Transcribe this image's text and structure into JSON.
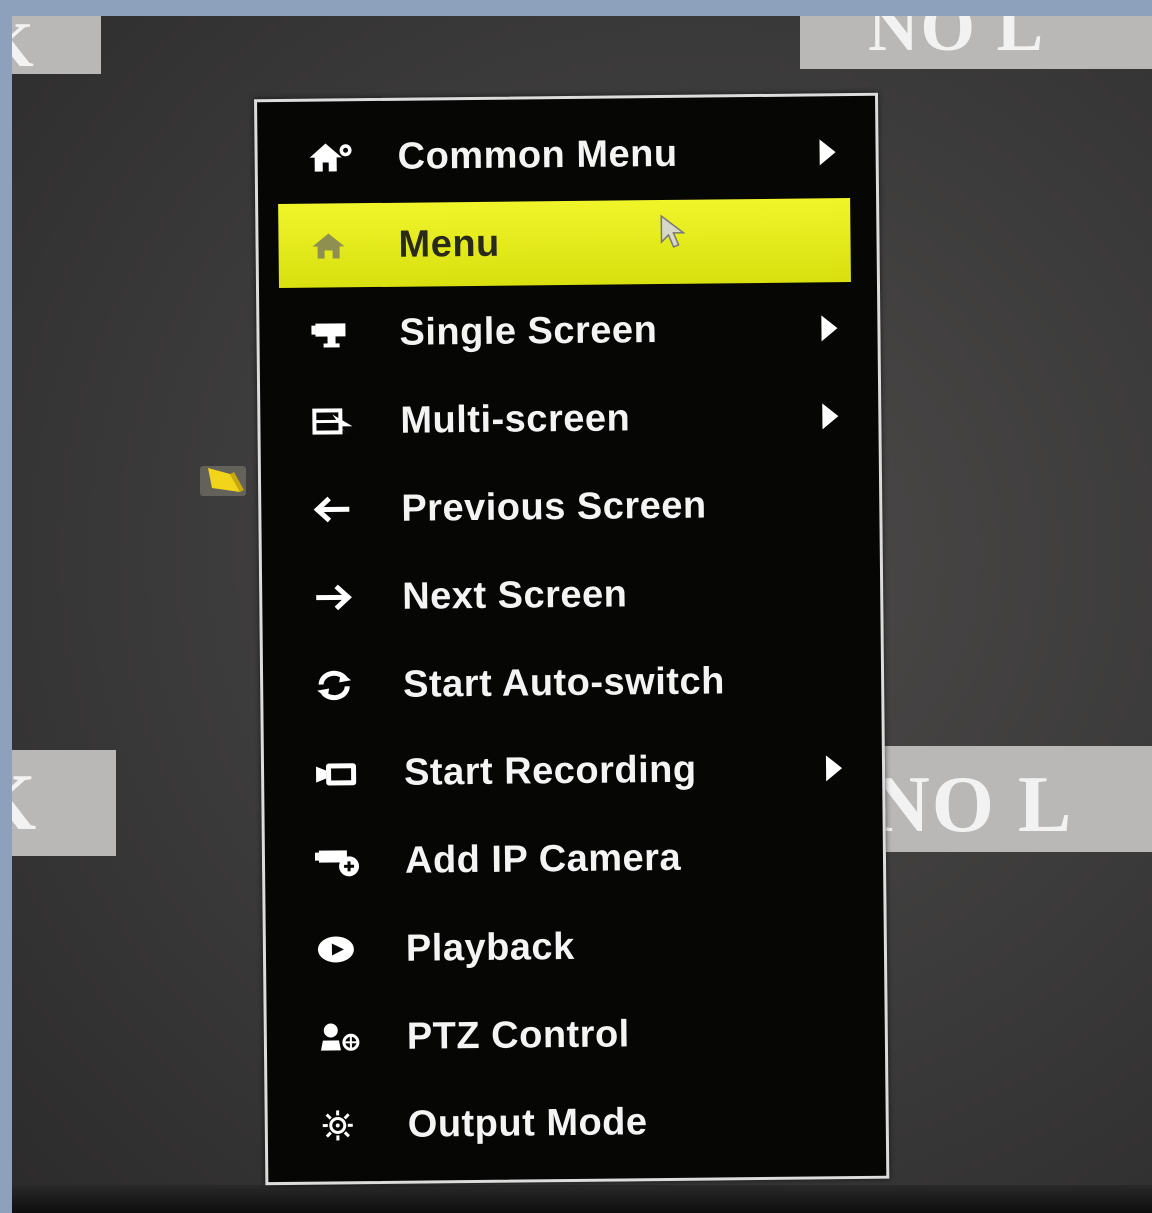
{
  "background_tiles": {
    "top_left": "K",
    "top_right": "NO L",
    "bottom_left": "K",
    "bottom_right": "NO L"
  },
  "menu": {
    "items": [
      {
        "label": "Common Menu",
        "icon": "home-gear-icon",
        "submenu": true
      },
      {
        "label": "Menu",
        "icon": "home-icon",
        "submenu": false,
        "highlighted": true
      },
      {
        "label": "Single Screen",
        "icon": "camera-icon",
        "submenu": true
      },
      {
        "label": "Multi-screen",
        "icon": "multi-screen-icon",
        "submenu": true
      },
      {
        "label": "Previous Screen",
        "icon": "arrow-left-icon",
        "submenu": false
      },
      {
        "label": "Next Screen",
        "icon": "arrow-right-icon",
        "submenu": false
      },
      {
        "label": "Start Auto-switch",
        "icon": "cycle-icon",
        "submenu": false
      },
      {
        "label": "Start Recording",
        "icon": "record-icon",
        "submenu": true
      },
      {
        "label": "Add IP Camera",
        "icon": "add-camera-icon",
        "submenu": false
      },
      {
        "label": "Playback",
        "icon": "playback-icon",
        "submenu": false
      },
      {
        "label": "PTZ Control",
        "icon": "ptz-icon",
        "submenu": false
      },
      {
        "label": "Output Mode",
        "icon": "output-mode-icon",
        "submenu": false
      }
    ]
  },
  "colors": {
    "highlight": "#e6ec1a",
    "menu_bg": "#060605",
    "menu_text": "#f4f4f4",
    "border": "#dcdcdc"
  }
}
